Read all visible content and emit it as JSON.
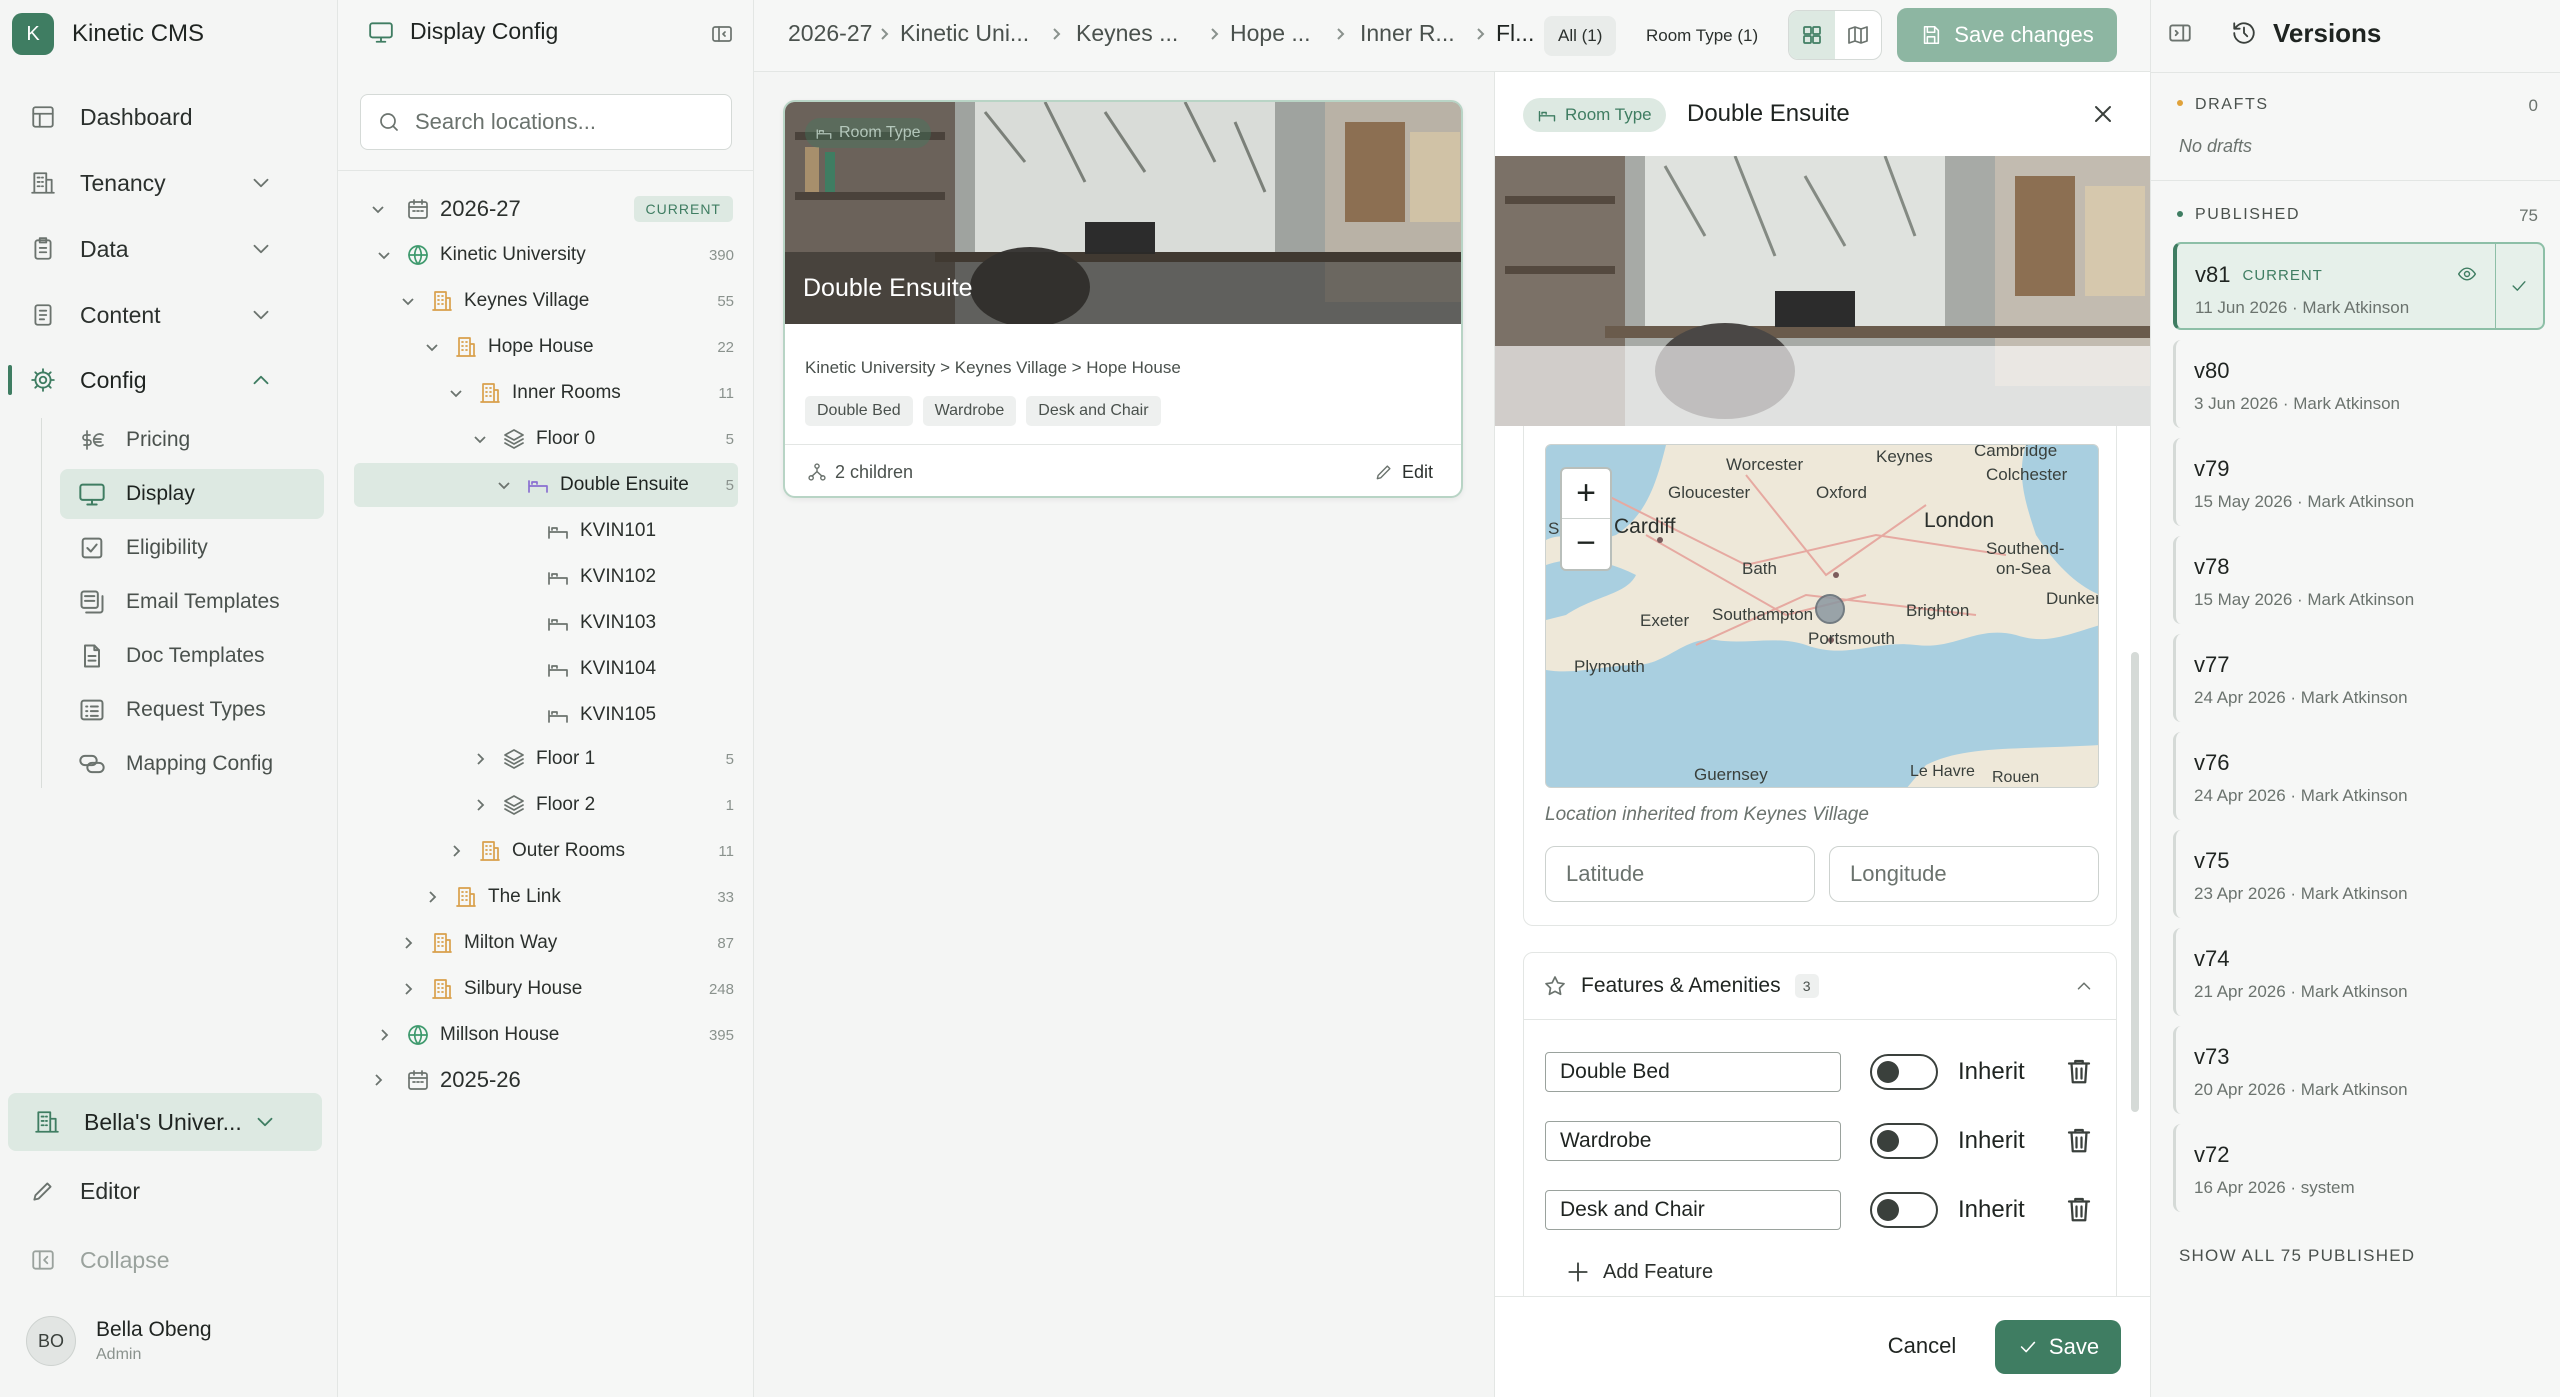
{
  "app": {
    "logo_letter": "K",
    "name": "Kinetic CMS"
  },
  "nav": {
    "items": [
      {
        "label": "Dashboard"
      },
      {
        "label": "Tenancy"
      },
      {
        "label": "Data"
      },
      {
        "label": "Content"
      },
      {
        "label": "Config"
      }
    ],
    "config_children": [
      {
        "label": "Pricing"
      },
      {
        "label": "Display"
      },
      {
        "label": "Eligibility"
      },
      {
        "label": "Email Templates"
      },
      {
        "label": "Doc Templates"
      },
      {
        "label": "Request Types"
      },
      {
        "label": "Mapping Config"
      }
    ],
    "tenant": "Bella's Univer...",
    "editor": "Editor",
    "collapse": "Collapse",
    "user": {
      "initials": "BO",
      "name": "Bella Obeng",
      "role": "Admin"
    },
    "accent": "#3f7d62"
  },
  "tree": {
    "title": "Display Config",
    "search_placeholder": "Search locations...",
    "current_badge": "CURRENT",
    "nodes": [
      {
        "label": "2026-27",
        "count": ""
      },
      {
        "label": "Kinetic University",
        "count": "390"
      },
      {
        "label": "Keynes Village",
        "count": "55"
      },
      {
        "label": "Hope House",
        "count": "22"
      },
      {
        "label": "Inner Rooms",
        "count": "11"
      },
      {
        "label": "Floor 0",
        "count": "5"
      },
      {
        "label": "Double Ensuite",
        "count": "5"
      },
      {
        "label": "KVIN101",
        "count": ""
      },
      {
        "label": "KVIN102",
        "count": ""
      },
      {
        "label": "KVIN103",
        "count": ""
      },
      {
        "label": "KVIN104",
        "count": ""
      },
      {
        "label": "KVIN105",
        "count": ""
      },
      {
        "label": "Floor 1",
        "count": "5"
      },
      {
        "label": "Floor 2",
        "count": "1"
      },
      {
        "label": "Outer Rooms",
        "count": "11"
      },
      {
        "label": "The Link",
        "count": "33"
      },
      {
        "label": "Milton Way",
        "count": "87"
      },
      {
        "label": "Silbury House",
        "count": "248"
      },
      {
        "label": "Millson House",
        "count": "395"
      },
      {
        "label": "2025-26",
        "count": ""
      }
    ]
  },
  "topbar": {
    "breadcrumbs": [
      "2026-27",
      "Kinetic Uni...",
      "Keynes ...",
      "Hope ...",
      "Inner R...",
      "Fl..."
    ],
    "filter_all": "All (1)",
    "filter_type": "Room Type (1)",
    "save_changes": "Save changes"
  },
  "card": {
    "type_badge": "Room Type",
    "title": "Double Ensuite",
    "path": "Kinetic University > Keynes Village > Hope House",
    "tags": [
      "Double Bed",
      "Wardrobe",
      "Desk and Chair"
    ],
    "children": "2 children",
    "edit": "Edit"
  },
  "drawer": {
    "type_badge": "Room Type",
    "title": "Double Ensuite",
    "map": {
      "zoom_in": "+",
      "zoom_out": "−",
      "places": [
        "Worcester",
        "Keynes",
        "Cambridge",
        "Colchester",
        "Gloucester",
        "Oxford",
        "Cardiff",
        "London",
        "Bath",
        "Southend-",
        "on-Sea",
        "Exeter",
        "Southampton",
        "Brighton",
        "Dunkerq",
        "Portsmouth",
        "Plymouth",
        "Guernsey",
        "Le Havre",
        "Rouen",
        "S"
      ]
    },
    "location_note": "Location inherited from Keynes Village",
    "latitude_placeholder": "Latitude",
    "longitude_placeholder": "Longitude",
    "features_title": "Features & Amenities",
    "features_count": "3",
    "features": [
      {
        "name": "Double Bed",
        "toggle_label": "Inherit"
      },
      {
        "name": "Wardrobe",
        "toggle_label": "Inherit"
      },
      {
        "name": "Desk and Chair",
        "toggle_label": "Inherit"
      }
    ],
    "add_feature": "Add Feature",
    "cancel": "Cancel",
    "save": "Save"
  },
  "versions": {
    "title": "Versions",
    "drafts_label": "DRAFTS",
    "drafts_count": "0",
    "no_drafts": "No drafts",
    "published_label": "PUBLISHED",
    "published_count": "75",
    "current_badge": "CURRENT",
    "items": [
      {
        "version": "v81",
        "meta": "11 Jun 2026 · Mark Atkinson"
      },
      {
        "version": "v80",
        "meta": "3 Jun 2026 · Mark Atkinson"
      },
      {
        "version": "v79",
        "meta": "15 May 2026 · Mark Atkinson"
      },
      {
        "version": "v78",
        "meta": "15 May 2026 · Mark Atkinson"
      },
      {
        "version": "v77",
        "meta": "24 Apr 2026 · Mark Atkinson"
      },
      {
        "version": "v76",
        "meta": "24 Apr 2026 · Mark Atkinson"
      },
      {
        "version": "v75",
        "meta": "23 Apr 2026 · Mark Atkinson"
      },
      {
        "version": "v74",
        "meta": "21 Apr 2026 · Mark Atkinson"
      },
      {
        "version": "v73",
        "meta": "20 Apr 2026 · Mark Atkinson"
      },
      {
        "version": "v72",
        "meta": "16 Apr 2026 · system"
      }
    ],
    "show_all": "SHOW ALL 75 PUBLISHED"
  }
}
